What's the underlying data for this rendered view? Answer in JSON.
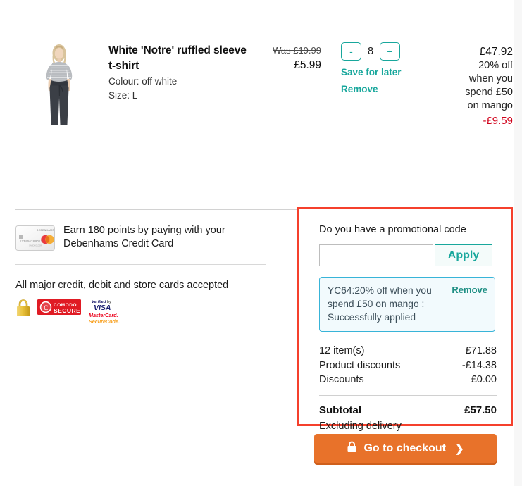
{
  "basket": {
    "item": {
      "title": "White 'Notre' ruffled sleeve t-shirt",
      "colour_label": "Colour: off white",
      "size_label": "Size: L",
      "was_price": "Was £19.99",
      "now_price": "£5.99",
      "quantity": "8",
      "decrease_label": "-",
      "increase_label": "+",
      "save_for_later_label": "Save for later",
      "remove_label": "Remove",
      "line_total": "£47.92",
      "promo_note_line1": "20% off",
      "promo_note_line2": "when you",
      "promo_note_line3": "spend £50",
      "promo_note_line4": "on mango",
      "line_discount": "-£9.59"
    }
  },
  "credit_card": {
    "message": "Earn 180 points by paying with your Debenhams Credit Card",
    "card_brand_text": "DEBENHAMS"
  },
  "security": {
    "cards_accepted": "All major credit, debit and store cards accepted",
    "comodo_line1": "COMODO",
    "comodo_line2": "SECURE",
    "visa_verified_by": "Verified by",
    "visa_brand": "VISA",
    "mastercard_brand": "MasterCard.",
    "mastercard_securecode": "SecureCode."
  },
  "promo": {
    "heading": "Do you have a promotional code",
    "input_value": "",
    "input_placeholder": "",
    "apply_label": "Apply",
    "applied_code_text": "YC64:20% off when you spend £50 on mango : Successfully applied",
    "applied_remove_label": "Remove"
  },
  "totals": {
    "rows": [
      {
        "label": "12 item(s)",
        "value": "£71.88"
      },
      {
        "label": "Product discounts",
        "value": "-£14.38"
      },
      {
        "label": "Discounts",
        "value": "£0.00"
      }
    ],
    "subtotal_label": "Subtotal",
    "subtotal_value": "£57.50",
    "subtotal_note": "Excluding delivery"
  },
  "checkout": {
    "label": "Go to checkout",
    "chevron": "❯"
  },
  "colors": {
    "teal": "#18a79c",
    "orange": "#e8722a",
    "red_highlight": "#f5402c",
    "discount_red": "#d0021b",
    "applied_border": "#38b4d8"
  }
}
